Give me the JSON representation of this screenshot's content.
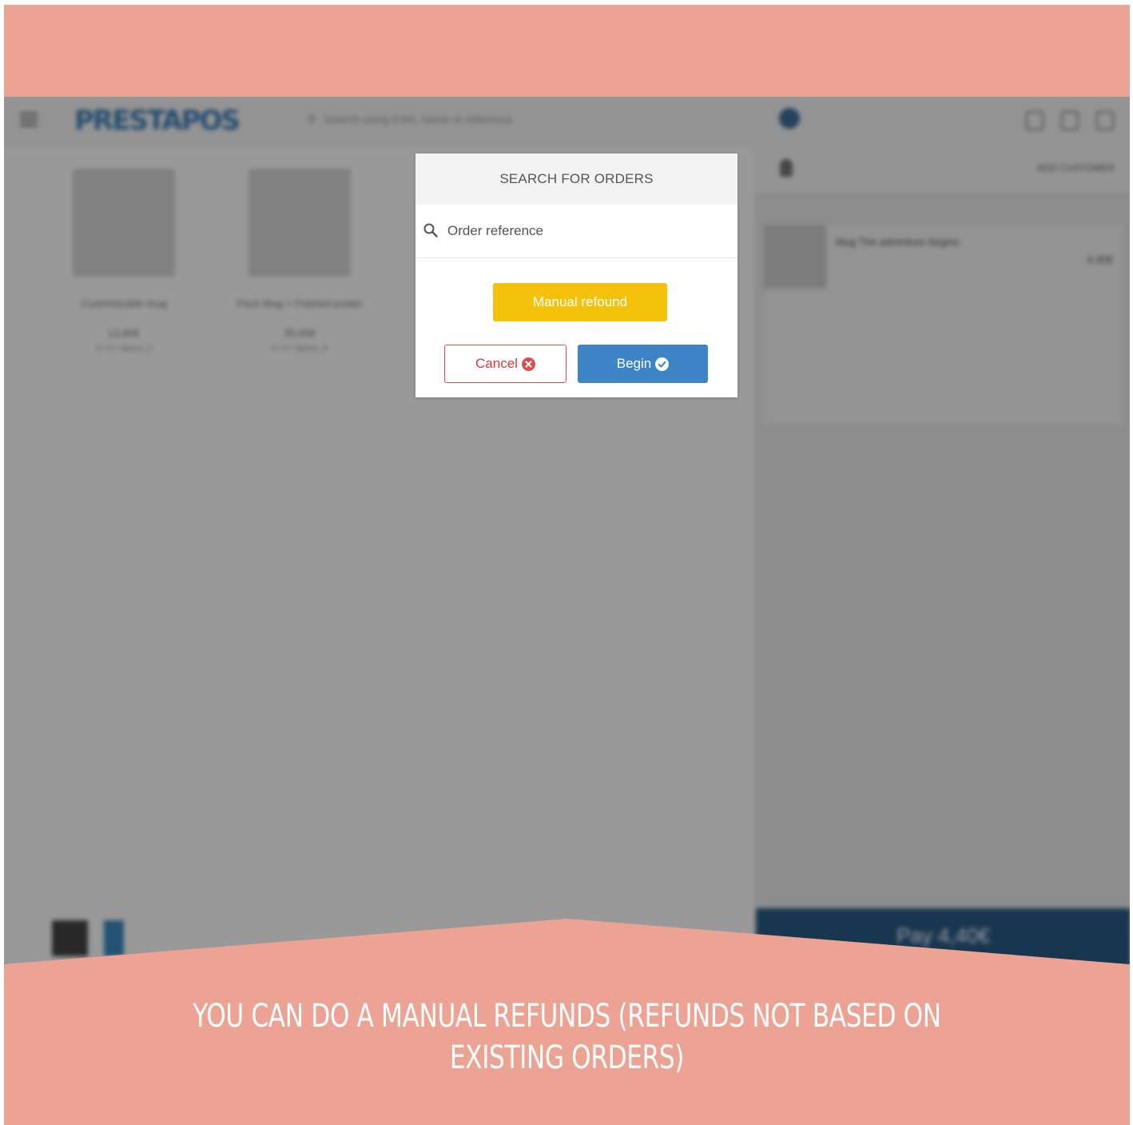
{
  "app": {
    "logo_text": "PRESTAPOS",
    "search_placeholder": "Search using EAN, name or reference",
    "products": [
      {
        "name": "Customizable mug",
        "price": "13,90€",
        "ref": "0 / 0 / demo_5"
      },
      {
        "name": "Pack Mug + Framed poster",
        "price": "35,00€",
        "ref": "0 / 0 / demo_9"
      }
    ],
    "cart": {
      "add_customer": "ADD CUSTOMER",
      "line_name": "Mug The adventure begins",
      "line_price": "4,40€",
      "pay_label": "Pay 4,40€"
    }
  },
  "modal": {
    "title": "SEARCH FOR ORDERS",
    "search_placeholder": "Order reference",
    "manual_refund_label": "Manual refound",
    "cancel_label": "Cancel",
    "begin_label": "Begin"
  },
  "caption": {
    "line1": "YOU CAN DO A MANUAL REFUNDS (REFUNDS NOT BASED ON",
    "line2": "EXISTING ORDERS)"
  },
  "colors": {
    "band": "#eca393",
    "manual_refund": "#f4c20d",
    "cancel_border": "#e04c4c",
    "begin": "#3d85c6"
  }
}
